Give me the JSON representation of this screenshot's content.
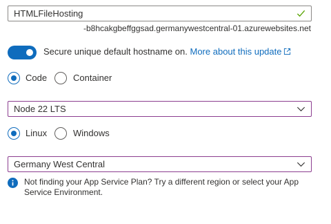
{
  "app_name": {
    "value": "HTMLFileHosting",
    "hostname_suffix": "-b8hcakgbeffggsad.germanywestcentral-01.azurewebsites.net"
  },
  "secure_hostname": {
    "enabled": true,
    "label": "Secure unique default hostname on.",
    "link_text": "More about this update"
  },
  "publish": {
    "options": [
      "Code",
      "Container"
    ],
    "selected": "Code"
  },
  "runtime_stack": {
    "value": "Node 22 LTS"
  },
  "operating_system": {
    "options": [
      "Linux",
      "Windows"
    ],
    "selected": "Linux"
  },
  "region": {
    "value": "Germany West Central"
  },
  "info_message": "Not finding your App Service Plan? Try a different region or select your App Service Environment.",
  "colors": {
    "accent": "#0f6cbd",
    "valid_check": "#57a300",
    "dropdown_border": "#8b3c8f"
  },
  "icons": [
    "checkmark-icon",
    "external-link-icon",
    "chevron-down-icon",
    "info-icon"
  ]
}
